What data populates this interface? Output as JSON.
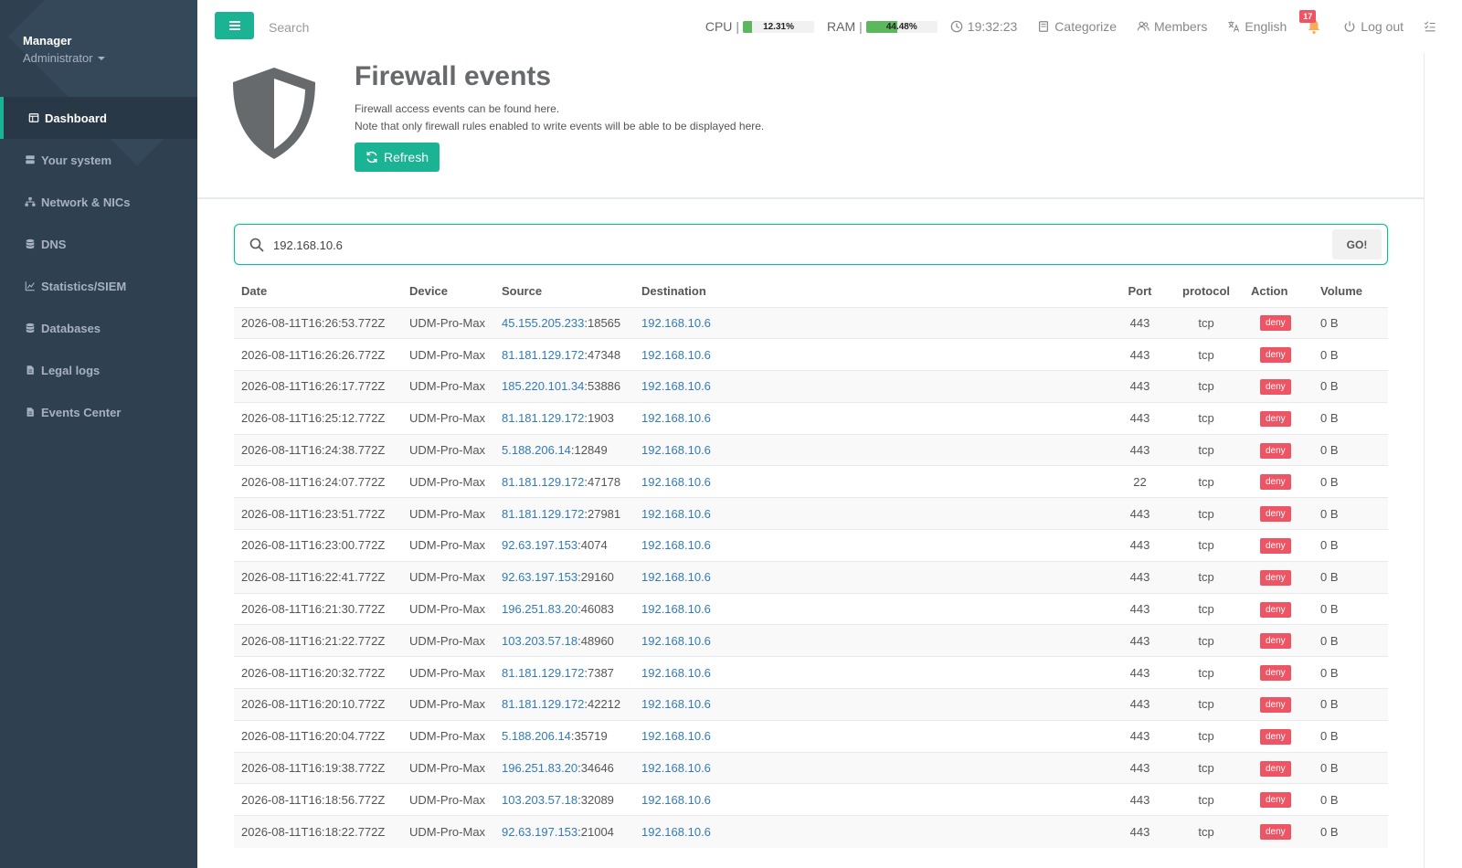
{
  "profile": {
    "name": "Manager",
    "role": "Administrator"
  },
  "sidebar": {
    "items": [
      {
        "label": "Dashboard",
        "icon": "dashboard-icon"
      },
      {
        "label": "Your system",
        "icon": "server-icon"
      },
      {
        "label": "Network & NICs",
        "icon": "network-icon"
      },
      {
        "label": "DNS",
        "icon": "database-icon"
      },
      {
        "label": "Statistics/SIEM",
        "icon": "chart-icon"
      },
      {
        "label": "Databases",
        "icon": "database-icon"
      },
      {
        "label": "Legal logs",
        "icon": "file-icon"
      },
      {
        "label": "Events Center",
        "icon": "file-icon"
      }
    ]
  },
  "topbar": {
    "search_placeholder": "Search",
    "cpu_label": "CPU",
    "cpu_value": "12.31%",
    "cpu_fraction": 0.1231,
    "ram_label": "RAM",
    "ram_value": "44.48%",
    "ram_fraction": 0.4448,
    "clock": "19:32:23",
    "categorize": "Categorize",
    "members": "Members",
    "language": "English",
    "notifications": "17",
    "logout": "Log out"
  },
  "header": {
    "title": "Firewall events",
    "desc_line1": "Firewall access events can be found here.",
    "desc_line2": "Note that only firewall rules enabled to write events will be able to be displayed here.",
    "refresh_label": "Refresh"
  },
  "search": {
    "value": "192.168.10.6",
    "go_label": "GO!"
  },
  "table": {
    "columns": {
      "date": "Date",
      "device": "Device",
      "source": "Source",
      "destination": "Destination",
      "port": "Port",
      "protocol": "protocol",
      "action": "Action",
      "volume": "Volume"
    },
    "rows": [
      {
        "date": "2026-08-11T16:26:53.772Z",
        "device": "UDM-Pro-Max",
        "src_ip": "45.155.205.233",
        "src_port": ":18565",
        "dest": "192.168.10.6",
        "port": "443",
        "protocol": "tcp",
        "action": "deny",
        "volume": "0 B"
      },
      {
        "date": "2026-08-11T16:26:26.772Z",
        "device": "UDM-Pro-Max",
        "src_ip": "81.181.129.172",
        "src_port": ":47348",
        "dest": "192.168.10.6",
        "port": "443",
        "protocol": "tcp",
        "action": "deny",
        "volume": "0 B"
      },
      {
        "date": "2026-08-11T16:26:17.772Z",
        "device": "UDM-Pro-Max",
        "src_ip": "185.220.101.34",
        "src_port": ":53886",
        "dest": "192.168.10.6",
        "port": "443",
        "protocol": "tcp",
        "action": "deny",
        "volume": "0 B"
      },
      {
        "date": "2026-08-11T16:25:12.772Z",
        "device": "UDM-Pro-Max",
        "src_ip": "81.181.129.172",
        "src_port": ":1903",
        "dest": "192.168.10.6",
        "port": "443",
        "protocol": "tcp",
        "action": "deny",
        "volume": "0 B"
      },
      {
        "date": "2026-08-11T16:24:38.772Z",
        "device": "UDM-Pro-Max",
        "src_ip": "5.188.206.14",
        "src_port": ":12849",
        "dest": "192.168.10.6",
        "port": "443",
        "protocol": "tcp",
        "action": "deny",
        "volume": "0 B"
      },
      {
        "date": "2026-08-11T16:24:07.772Z",
        "device": "UDM-Pro-Max",
        "src_ip": "81.181.129.172",
        "src_port": ":47178",
        "dest": "192.168.10.6",
        "port": "22",
        "protocol": "tcp",
        "action": "deny",
        "volume": "0 B"
      },
      {
        "date": "2026-08-11T16:23:51.772Z",
        "device": "UDM-Pro-Max",
        "src_ip": "81.181.129.172",
        "src_port": ":27981",
        "dest": "192.168.10.6",
        "port": "443",
        "protocol": "tcp",
        "action": "deny",
        "volume": "0 B"
      },
      {
        "date": "2026-08-11T16:23:00.772Z",
        "device": "UDM-Pro-Max",
        "src_ip": "92.63.197.153",
        "src_port": ":4074",
        "dest": "192.168.10.6",
        "port": "443",
        "protocol": "tcp",
        "action": "deny",
        "volume": "0 B"
      },
      {
        "date": "2026-08-11T16:22:41.772Z",
        "device": "UDM-Pro-Max",
        "src_ip": "92.63.197.153",
        "src_port": ":29160",
        "dest": "192.168.10.6",
        "port": "443",
        "protocol": "tcp",
        "action": "deny",
        "volume": "0 B"
      },
      {
        "date": "2026-08-11T16:21:30.772Z",
        "device": "UDM-Pro-Max",
        "src_ip": "196.251.83.20",
        "src_port": ":46083",
        "dest": "192.168.10.6",
        "port": "443",
        "protocol": "tcp",
        "action": "deny",
        "volume": "0 B"
      },
      {
        "date": "2026-08-11T16:21:22.772Z",
        "device": "UDM-Pro-Max",
        "src_ip": "103.203.57.18",
        "src_port": ":48960",
        "dest": "192.168.10.6",
        "port": "443",
        "protocol": "tcp",
        "action": "deny",
        "volume": "0 B"
      },
      {
        "date": "2026-08-11T16:20:32.772Z",
        "device": "UDM-Pro-Max",
        "src_ip": "81.181.129.172",
        "src_port": ":7387",
        "dest": "192.168.10.6",
        "port": "443",
        "protocol": "tcp",
        "action": "deny",
        "volume": "0 B"
      },
      {
        "date": "2026-08-11T16:20:10.772Z",
        "device": "UDM-Pro-Max",
        "src_ip": "81.181.129.172",
        "src_port": ":42212",
        "dest": "192.168.10.6",
        "port": "443",
        "protocol": "tcp",
        "action": "deny",
        "volume": "0 B"
      },
      {
        "date": "2026-08-11T16:20:04.772Z",
        "device": "UDM-Pro-Max",
        "src_ip": "5.188.206.14",
        "src_port": ":35719",
        "dest": "192.168.10.6",
        "port": "443",
        "protocol": "tcp",
        "action": "deny",
        "volume": "0 B"
      },
      {
        "date": "2026-08-11T16:19:38.772Z",
        "device": "UDM-Pro-Max",
        "src_ip": "196.251.83.20",
        "src_port": ":34646",
        "dest": "192.168.10.6",
        "port": "443",
        "protocol": "tcp",
        "action": "deny",
        "volume": "0 B"
      },
      {
        "date": "2026-08-11T16:18:56.772Z",
        "device": "UDM-Pro-Max",
        "src_ip": "103.203.57.18",
        "src_port": ":32089",
        "dest": "192.168.10.6",
        "port": "443",
        "protocol": "tcp",
        "action": "deny",
        "volume": "0 B"
      },
      {
        "date": "2026-08-11T16:18:22.772Z",
        "device": "UDM-Pro-Max",
        "src_ip": "92.63.197.153",
        "src_port": ":21004",
        "dest": "192.168.10.6",
        "port": "443",
        "protocol": "tcp",
        "action": "deny",
        "volume": "0 B"
      }
    ]
  },
  "colors": {
    "accent": "#1ab394",
    "sidebar": "#2f4050",
    "deny": "#ed5565",
    "link": "#337ab7"
  }
}
